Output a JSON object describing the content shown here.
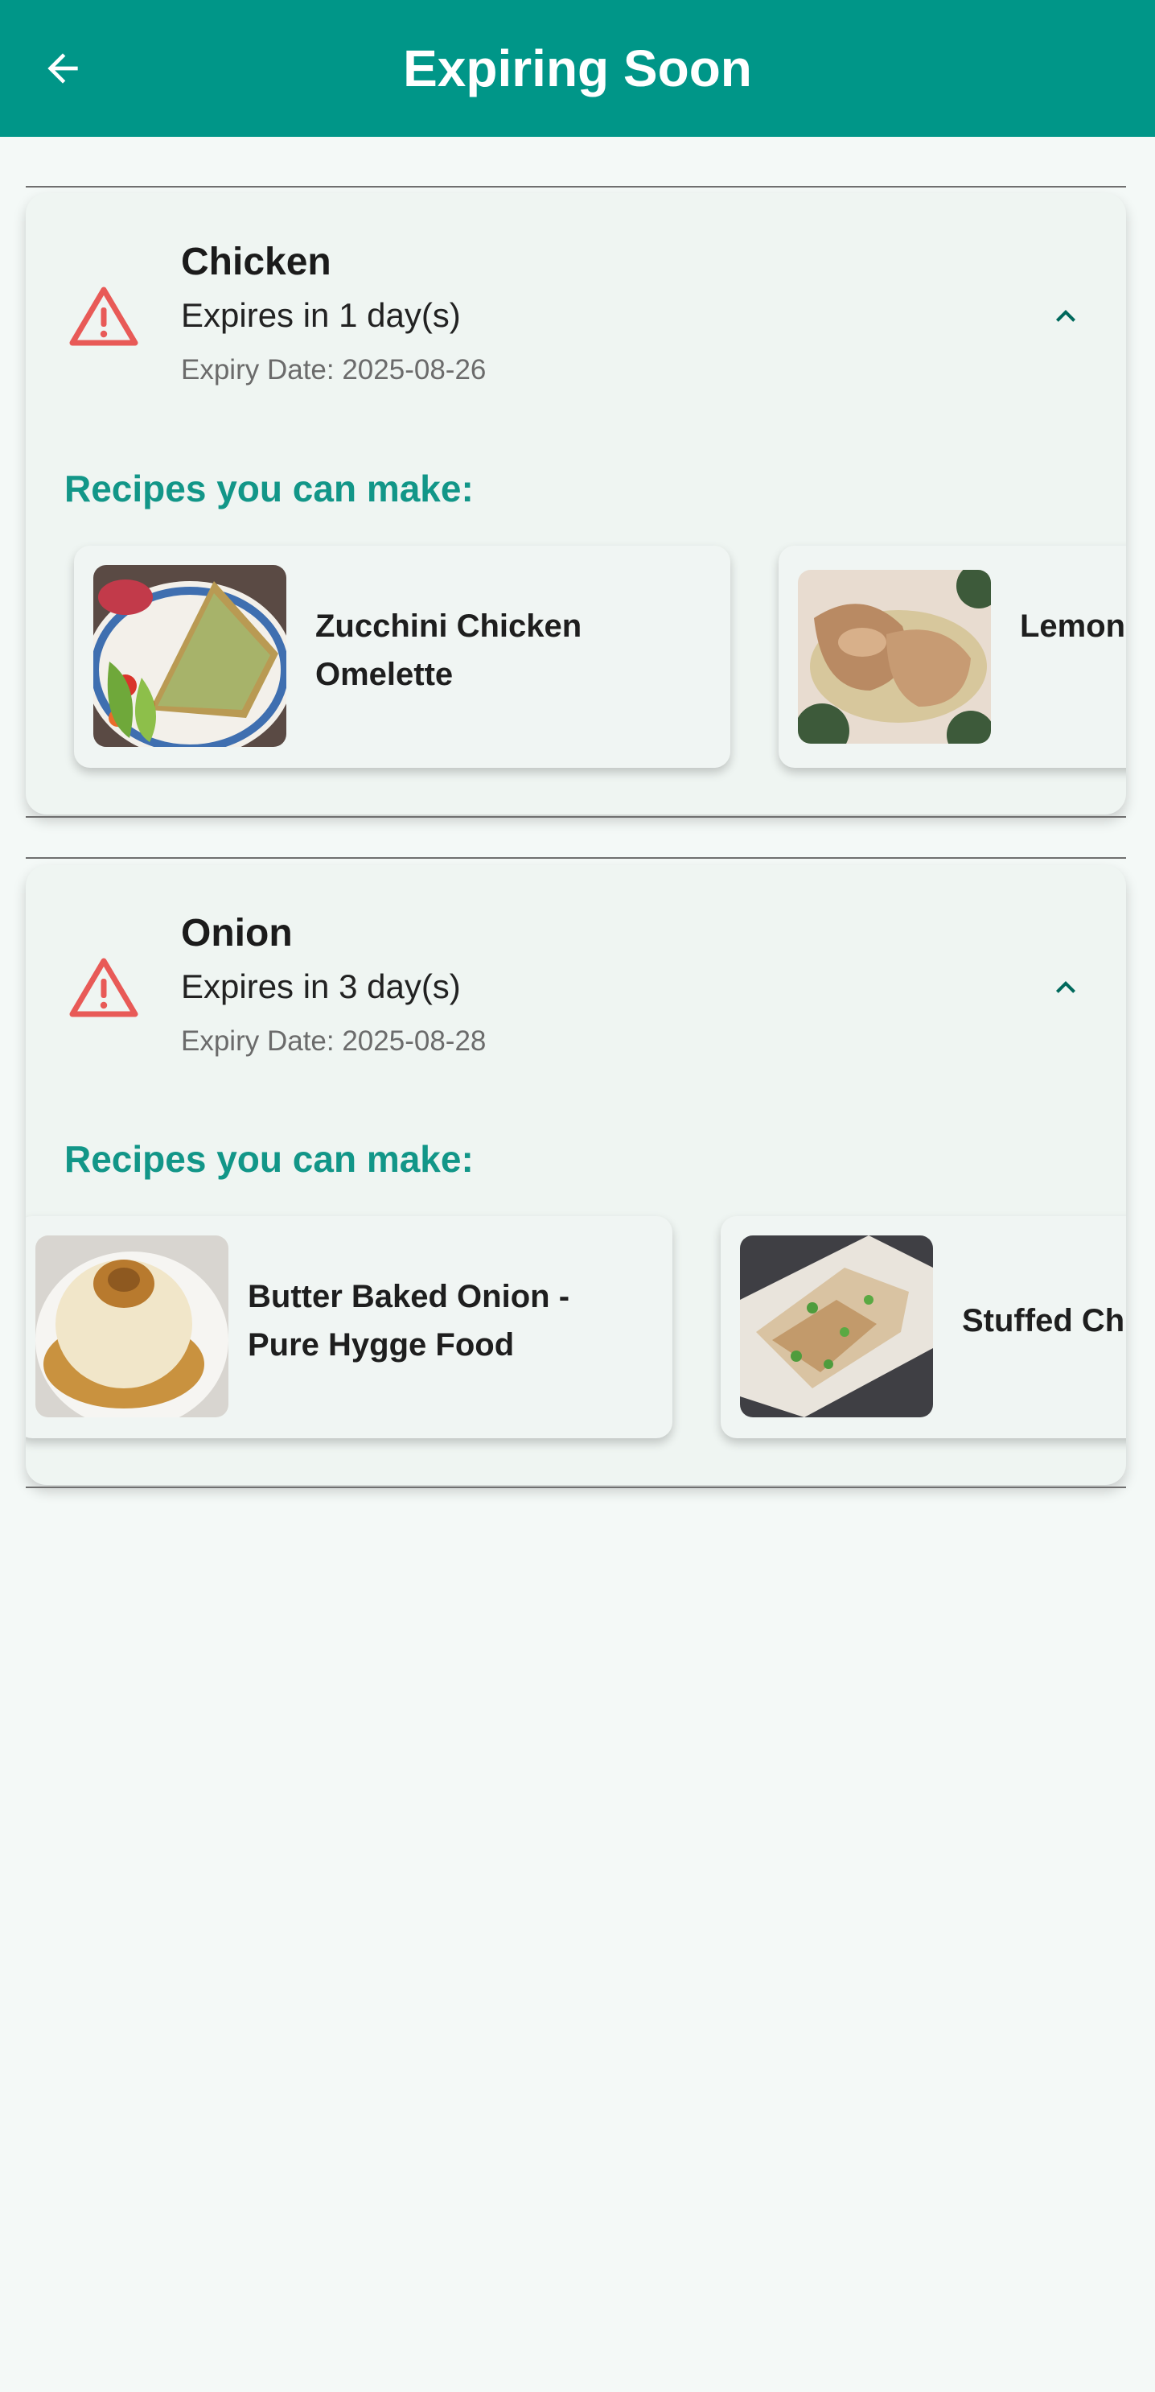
{
  "app_bar": {
    "title": "Expiring Soon",
    "back_icon": "arrow-left-icon",
    "color": "#009688"
  },
  "section_heading": "Recipes you can make:",
  "items": [
    {
      "name": "Chicken",
      "expires_text": "Expires in 1 day(s)",
      "expiry_date_text": "Expiry Date: 2025-08-26",
      "status_icon": "warning-triangle-icon",
      "expand_icon": "chevron-up-icon",
      "recipes": [
        {
          "title": "Zucchini Chicken Omelette",
          "image": "omelette-photo"
        },
        {
          "title": "Lemon Roaste",
          "image": "roast-chicken-photo"
        }
      ]
    },
    {
      "name": "Onion",
      "expires_text": "Expires in 3 day(s)",
      "expiry_date_text": "Expiry Date: 2025-08-28",
      "status_icon": "warning-triangle-icon",
      "expand_icon": "chevron-up-icon",
      "recipes": [
        {
          "title": "Butter Baked Onion - Pure Hygge Food",
          "image": "baked-onion-photo"
        },
        {
          "title": "Stuffed Ch",
          "image": "stuffed-chicken-photo"
        }
      ]
    }
  ],
  "colors": {
    "warning": "#e85a57",
    "accent": "#129688",
    "chevron": "#00695c",
    "background": "#f4f9f7"
  }
}
